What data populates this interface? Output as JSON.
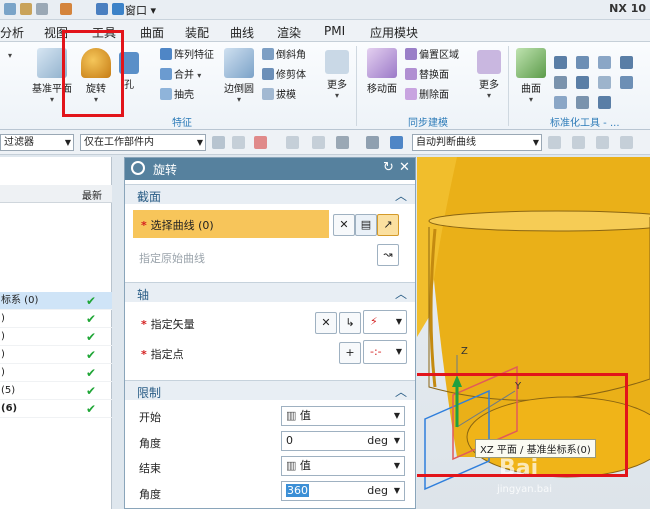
{
  "titlebar": {
    "window_menu": "窗口",
    "app_title": "NX 10"
  },
  "menu": {
    "tabs": [
      "分析",
      "视图",
      "工具",
      "曲面",
      "装配",
      "曲线",
      "渲染",
      "PMI",
      "应用模块"
    ]
  },
  "ribbon": {
    "datum_plane": "基准平面",
    "revolve": "旋转",
    "hole": "孔",
    "pattern_feature": "阵列特征",
    "combine": "合并",
    "shell": "抽壳",
    "edge_blend": "边倒圆",
    "chamfer": "倒斜角",
    "trim_body": "修剪体",
    "draft": "拔模",
    "more1": "更多",
    "move_face": "移动面",
    "offset_region": "偏置区域",
    "replace_face": "替换面",
    "delete_face": "删除面",
    "more2": "更多",
    "surface": "曲面",
    "feature_group": "特征",
    "sync_group": "同步建模",
    "std_tools_group": "标准化工具 - ..."
  },
  "filterbar": {
    "type_filter": "过滤器",
    "scope_filter": "仅在工作部件内",
    "curve_rule": "自动判断曲线"
  },
  "navigator": {
    "column_latest": "最新",
    "rows": [
      {
        "text": "标系 (0)",
        "selected": true
      },
      {
        "text": ")",
        "selected": false
      },
      {
        "text": ")",
        "selected": false
      },
      {
        "text": ")",
        "selected": false
      },
      {
        "text": ")",
        "selected": false
      },
      {
        "text": "(5)",
        "selected": false
      },
      {
        "text": "(6)",
        "selected": false
      }
    ]
  },
  "dialog": {
    "title": "旋转",
    "section_title": "截面",
    "select_curve": "选择曲线 (0)",
    "specify_origin_curve": "指定原始曲线",
    "axis_title": "轴",
    "specify_vector": "指定矢量",
    "specify_point": "指定点",
    "limits_title": "限制",
    "start_label": "开始",
    "start_type": "值",
    "start_angle_label": "角度",
    "start_angle": "0",
    "end_label": "结束",
    "end_type": "值",
    "end_angle_label": "角度",
    "end_angle": "360",
    "unit": "deg"
  },
  "view": {
    "tooltip": "XZ 平面 / 基准坐标系(0)",
    "axis_z": "Z",
    "axis_y": "Y",
    "watermark": "Bai",
    "watermark_url": "jingyan.bai"
  },
  "colors": {
    "highlight_red": "#e2141a",
    "selection_orange": "#f7c55a",
    "dialog_title": "#56819e",
    "part_yellow": "#f0b418"
  }
}
